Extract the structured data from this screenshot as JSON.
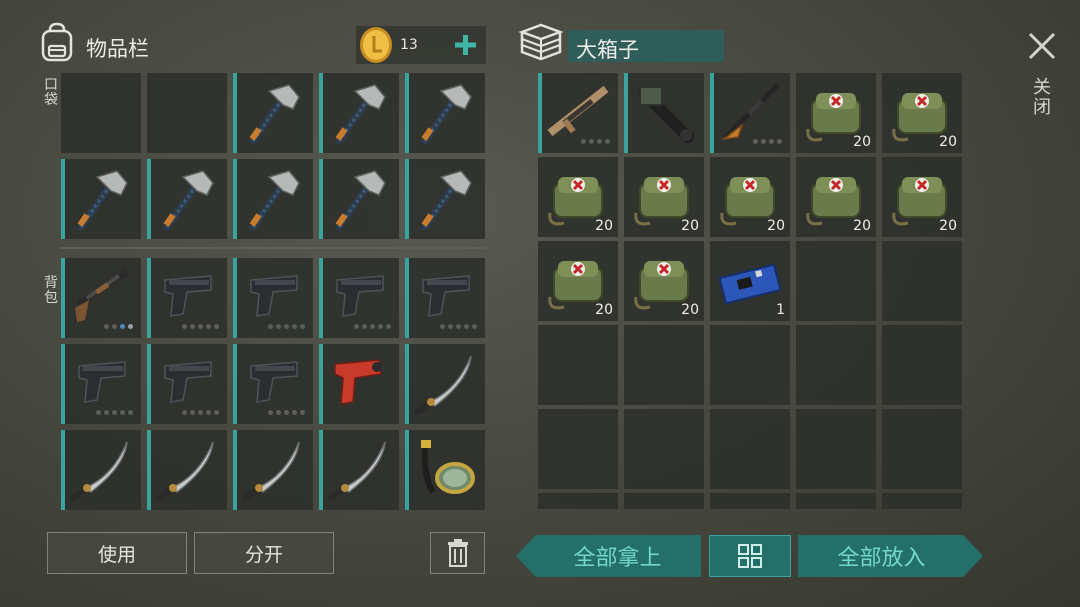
{
  "inventory": {
    "title": "物品栏",
    "coin_count": "13",
    "pocket_label": "口袋",
    "backpack_label": "背包",
    "pocket_slots": [
      {
        "item": "",
        "qty": ""
      },
      {
        "item": "",
        "qty": ""
      },
      {
        "item": "hatchet",
        "qty": ""
      },
      {
        "item": "hatchet",
        "qty": ""
      },
      {
        "item": "hatchet",
        "qty": ""
      },
      {
        "item": "hatchet",
        "qty": ""
      },
      {
        "item": "hatchet",
        "qty": ""
      },
      {
        "item": "hatchet",
        "qty": ""
      },
      {
        "item": "hatchet",
        "qty": ""
      },
      {
        "item": "hatchet",
        "qty": ""
      }
    ],
    "backpack_slots": [
      {
        "item": "shotgun",
        "qty": ""
      },
      {
        "item": "pistol",
        "qty": ""
      },
      {
        "item": "pistol",
        "qty": ""
      },
      {
        "item": "pistol",
        "qty": ""
      },
      {
        "item": "pistol",
        "qty": ""
      },
      {
        "item": "pistol",
        "qty": ""
      },
      {
        "item": "pistol",
        "qty": ""
      },
      {
        "item": "pistol",
        "qty": ""
      },
      {
        "item": "flare-gun",
        "qty": ""
      },
      {
        "item": "machete",
        "qty": ""
      },
      {
        "item": "machete",
        "qty": ""
      },
      {
        "item": "machete",
        "qty": ""
      },
      {
        "item": "machete",
        "qty": ""
      },
      {
        "item": "machete",
        "qty": ""
      },
      {
        "item": "diving-mask",
        "qty": ""
      }
    ],
    "use_button": "使用",
    "split_button": "分开"
  },
  "container": {
    "title": "大箱子",
    "slots": [
      {
        "item": "assault-rifle",
        "qty": ""
      },
      {
        "item": "minigun",
        "qty": ""
      },
      {
        "item": "sniper-rifle",
        "qty": ""
      },
      {
        "item": "first-aid-bag",
        "qty": "20"
      },
      {
        "item": "first-aid-bag",
        "qty": "20"
      },
      {
        "item": "first-aid-bag",
        "qty": "20"
      },
      {
        "item": "first-aid-bag",
        "qty": "20"
      },
      {
        "item": "first-aid-bag",
        "qty": "20"
      },
      {
        "item": "first-aid-bag",
        "qty": "20"
      },
      {
        "item": "first-aid-bag",
        "qty": "20"
      },
      {
        "item": "first-aid-bag",
        "qty": "20"
      },
      {
        "item": "first-aid-bag",
        "qty": "20"
      },
      {
        "item": "circuit-board",
        "qty": "1"
      },
      {
        "item": "",
        "qty": ""
      },
      {
        "item": "",
        "qty": ""
      },
      {
        "item": "",
        "qty": ""
      },
      {
        "item": "",
        "qty": ""
      },
      {
        "item": "",
        "qty": ""
      },
      {
        "item": "",
        "qty": ""
      },
      {
        "item": "",
        "qty": ""
      },
      {
        "item": "",
        "qty": ""
      },
      {
        "item": "",
        "qty": ""
      },
      {
        "item": "",
        "qty": ""
      },
      {
        "item": "",
        "qty": ""
      },
      {
        "item": "",
        "qty": ""
      }
    ],
    "take_all_button": "全部拿上",
    "put_all_button": "全部放入"
  },
  "close_label": "关闭",
  "colors": {
    "accent_teal": "#3aa39e",
    "button_teal": "#256f6a",
    "text_teal": "#72d8cc",
    "coin": "#e9b43c"
  }
}
